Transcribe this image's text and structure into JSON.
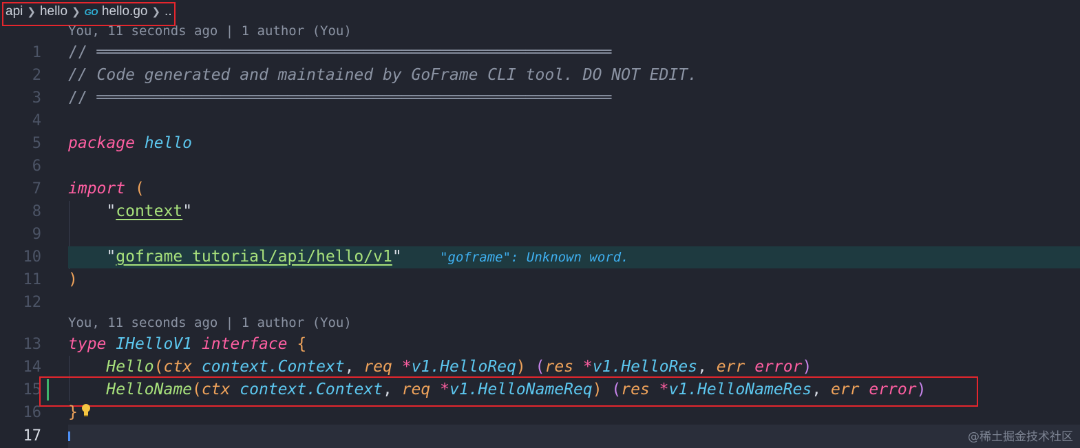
{
  "breadcrumb": {
    "items": [
      "api",
      "hello",
      "hello.go"
    ],
    "file_icon": "GO",
    "trailing": ".."
  },
  "codelens": {
    "top": "You, 11 seconds ago | 1 author (You)",
    "interface": "You, 11 seconds ago | 1 author (You)"
  },
  "lines": {
    "n1": "1",
    "n2": "2",
    "n3": "3",
    "n4": "4",
    "n5": "5",
    "n6": "6",
    "n7": "7",
    "n8": "8",
    "n9": "9",
    "n10": "10",
    "n11": "11",
    "n12": "12",
    "n13": "13",
    "n14": "14",
    "n15": "15",
    "n16": "16",
    "n17": "17"
  },
  "code": {
    "l1": "// ══════════════════════════════════════════════════════",
    "l2": "// Code generated and maintained by GoFrame CLI tool. DO NOT EDIT.",
    "l3": "// ══════════════════════════════════════════════════════",
    "kw_package": "package",
    "pkg_name": "hello",
    "kw_import": "import",
    "open_paren": "(",
    "import1": "context",
    "import2": "goframe_tutorial/api/hello/v1",
    "close_paren": ")",
    "kw_type": "type",
    "iface_name": "IHelloV1",
    "kw_interface": "interface",
    "open_brace": "{",
    "close_brace": "}",
    "m1_name": "Hello",
    "m2_name": "HelloName",
    "ctx": "ctx",
    "ctx_type": "context.Context",
    "req": "req",
    "star": "*",
    "v1": "v1.",
    "m1_req": "HelloReq",
    "m2_req": "HelloNameReq",
    "res": "res",
    "m1_res": "HelloRes",
    "m2_res": "HelloNameRes",
    "err": "err",
    "error": "error",
    "comma": ", "
  },
  "diagnostic": "\"goframe\": Unknown word.",
  "watermark": "@稀土掘金技术社区",
  "colors": {
    "background": "#22252f",
    "highlight_border": "#e5262d",
    "keyword": "#ff5fa2",
    "type": "#5cc7ef",
    "function": "#a8e27c",
    "param": "#f1a45b"
  }
}
